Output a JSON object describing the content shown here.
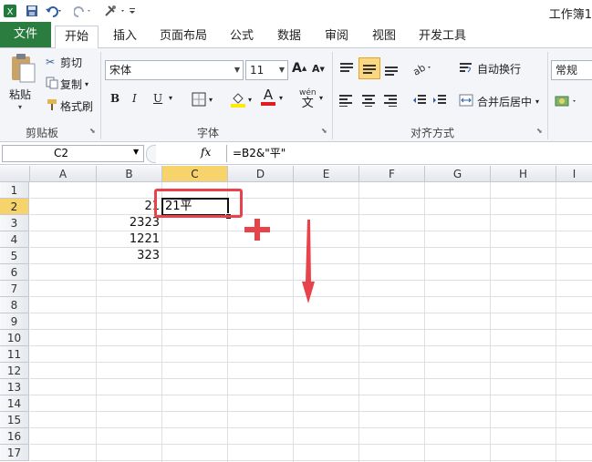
{
  "window": {
    "title": "工作簿1"
  },
  "tabs": [
    {
      "id": "file",
      "label": "文件"
    },
    {
      "id": "home",
      "label": "开始"
    },
    {
      "id": "insert",
      "label": "插入"
    },
    {
      "id": "layout",
      "label": "页面布局"
    },
    {
      "id": "formulas",
      "label": "公式"
    },
    {
      "id": "data",
      "label": "数据"
    },
    {
      "id": "review",
      "label": "审阅"
    },
    {
      "id": "view",
      "label": "视图"
    },
    {
      "id": "developer",
      "label": "开发工具"
    }
  ],
  "clipboard": {
    "paste": "粘贴",
    "cut": "剪切",
    "copy": "复制",
    "format_painter": "格式刷",
    "group": "剪贴板"
  },
  "font": {
    "name": "宋体",
    "size": "11",
    "group": "字体",
    "bold": "B",
    "italic": "I",
    "underline": "U",
    "font_color_glyph": "A",
    "phonetic_top": "wén",
    "phonetic_bottom": "文"
  },
  "alignment": {
    "wrap": "自动换行",
    "merge": "合并后居中",
    "group": "对齐方式"
  },
  "number": {
    "format": "常规"
  },
  "formula_bar": {
    "name_box": "C2",
    "fx": "fx",
    "formula": "=B2&\"平\""
  },
  "columns": [
    "A",
    "B",
    "C",
    "D",
    "E",
    "F",
    "G",
    "H",
    "I"
  ],
  "rows": [
    "1",
    "2",
    "3",
    "4",
    "5",
    "6",
    "7",
    "8",
    "9",
    "10",
    "11",
    "12",
    "13",
    "14",
    "15",
    "16",
    "17"
  ],
  "cells": {
    "B2": "21",
    "B3": "2323",
    "B4": "1221",
    "B5": "323",
    "C2": "21平"
  },
  "active_cell": "C2",
  "colors": {
    "file_tab": "#2a7d3f",
    "selection_highlight": "#f7d36b",
    "annotation": "#e8424b"
  }
}
